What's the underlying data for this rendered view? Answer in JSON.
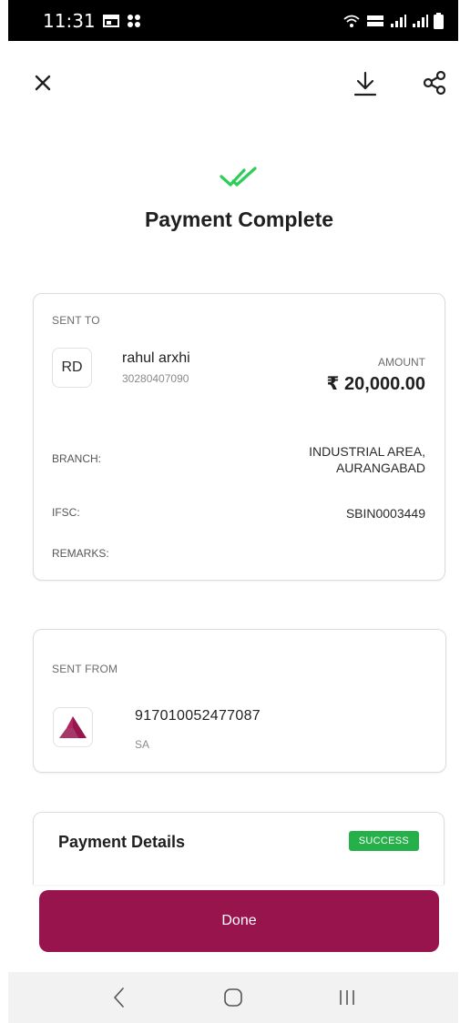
{
  "status_bar": {
    "time": "11:31"
  },
  "header": {
    "title": "Payment Complete"
  },
  "sent_to": {
    "label": "SENT TO",
    "avatar_initials": "RD",
    "name": "rahul arxhi",
    "account": "30280407090",
    "amount_label": "AMOUNT",
    "amount": "₹ 20,000.00",
    "branch_label": "BRANCH:",
    "branch_line1": "INDUSTRIAL AREA,",
    "branch_line2": "AURANGABAD",
    "ifsc_label": "IFSC:",
    "ifsc": "SBIN0003449",
    "remarks_label": "REMARKS:"
  },
  "sent_from": {
    "label": "SENT FROM",
    "account": "917010052477087",
    "account_type": "SA"
  },
  "payment_details": {
    "title": "Payment Details",
    "status": "SUCCESS"
  },
  "done_label": "Done",
  "icons": {
    "close": "close-icon",
    "download": "download-icon",
    "share": "share-icon",
    "success": "double-check-icon",
    "bank_logo": "axis-bank-logo-icon"
  },
  "colors": {
    "brand": "#97144d",
    "success": "#26b04a",
    "check": "#2ecc5a"
  }
}
